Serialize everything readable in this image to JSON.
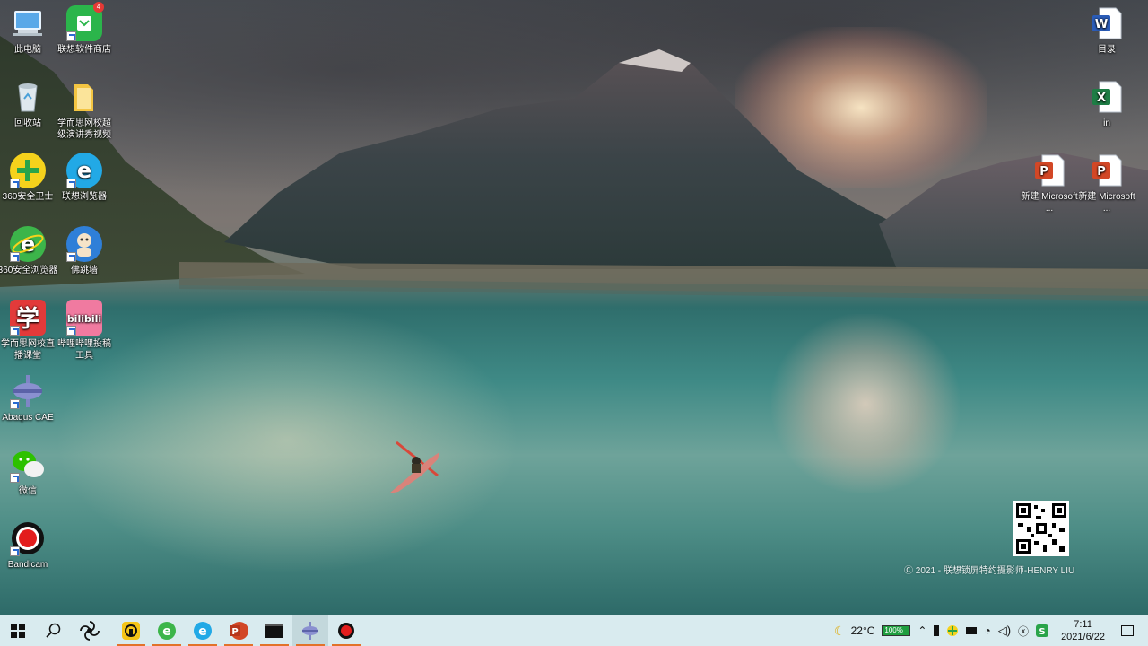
{
  "desktop": {
    "left_icons": [
      {
        "label": "此电脑",
        "icon": "computer-icon"
      },
      {
        "label": "联想软件商店",
        "icon": "lenovo-store-icon",
        "badge": "4"
      },
      {
        "label": "回收站",
        "icon": "recycle-bin-icon"
      },
      {
        "label": "学而思网校超级演讲秀视频",
        "icon": "folder-icon"
      },
      {
        "label": "360安全卫士",
        "icon": "360-security-icon"
      },
      {
        "label": "联想浏览器",
        "icon": "lenovo-browser-icon"
      },
      {
        "label": "360安全浏览器",
        "icon": "360-browser-icon"
      },
      {
        "label": "佛跳墙",
        "icon": "fotiaoqiang-icon"
      },
      {
        "label": "学而思网校直播课堂",
        "icon": "xueersi-icon"
      },
      {
        "label": "哔哩哔哩投稿工具",
        "icon": "bilibili-icon"
      },
      {
        "label": "Abaqus CAE",
        "icon": "abaqus-icon"
      },
      {
        "label": "微信",
        "icon": "wechat-icon"
      },
      {
        "label": "Bandicam",
        "icon": "bandicam-icon"
      }
    ],
    "right_icons": [
      {
        "label": "目录",
        "icon": "word-doc-icon"
      },
      {
        "label": "in",
        "icon": "excel-doc-icon"
      },
      {
        "label": "新建 Microsoft ...",
        "icon": "powerpoint-doc-icon"
      },
      {
        "label": "新建 Microsoft ...",
        "icon": "powerpoint-doc-icon"
      }
    ],
    "watermark": "2021 - 联想锁屏特约摄影师-HENRY LIU"
  },
  "taskbar": {
    "apps": [
      {
        "name": "start-button",
        "icon": "windows-icon"
      },
      {
        "name": "search-button",
        "icon": "search-icon"
      },
      {
        "name": "app-pinwheel",
        "icon": "pinwheel-icon"
      },
      {
        "name": "app-qq-music",
        "icon": "music-app-icon",
        "active": true
      },
      {
        "name": "app-360-browser",
        "icon": "360-browser-icon",
        "active": true
      },
      {
        "name": "app-lenovo-browser",
        "icon": "lenovo-browser-icon",
        "active": true
      },
      {
        "name": "app-powerpoint",
        "icon": "powerpoint-icon",
        "active": true
      },
      {
        "name": "app-terminal",
        "icon": "terminal-icon",
        "active": true
      },
      {
        "name": "app-abaqus",
        "icon": "abaqus-icon",
        "active": true,
        "selected": true
      },
      {
        "name": "app-bandicam",
        "icon": "record-icon",
        "active": true
      }
    ],
    "tray": {
      "weather": "22°C",
      "battery_text": "100%",
      "time": "7:11",
      "date": "2021/6/22"
    }
  }
}
